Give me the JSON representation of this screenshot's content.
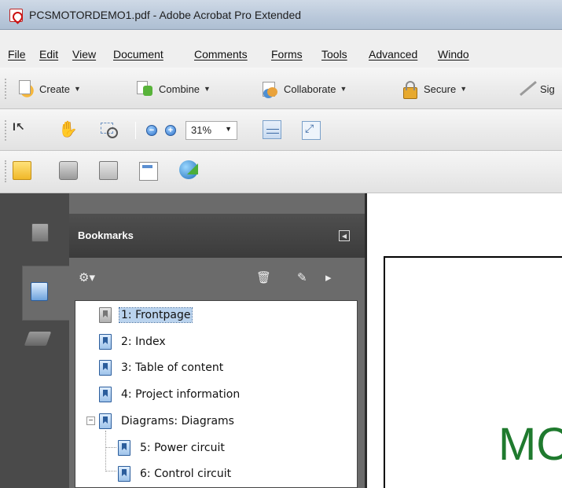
{
  "window": {
    "title": "PCSMOTORDEMO1.pdf - Adobe Acrobat Pro Extended"
  },
  "menubar": {
    "items": [
      "File",
      "Edit",
      "View",
      "Document",
      "Comments",
      "Forms",
      "Tools",
      "Advanced",
      "Windo"
    ]
  },
  "task_toolbar": {
    "create": "Create",
    "combine": "Combine",
    "collaborate": "Collaborate",
    "secure": "Secure",
    "sign": "Sig"
  },
  "zoom": {
    "value": "31%"
  },
  "bookmarks": {
    "title": "Bookmarks",
    "items": [
      {
        "label": "1: Frontpage",
        "selected": true
      },
      {
        "label": "2: Index"
      },
      {
        "label": "3: Table of content"
      },
      {
        "label": "4: Project information"
      },
      {
        "label": "Diagrams: Diagrams",
        "expander": "⊟"
      },
      {
        "label": "5: Power circuit"
      },
      {
        "label": "6: Control circuit"
      }
    ]
  },
  "document": {
    "visible_text": "MO"
  }
}
